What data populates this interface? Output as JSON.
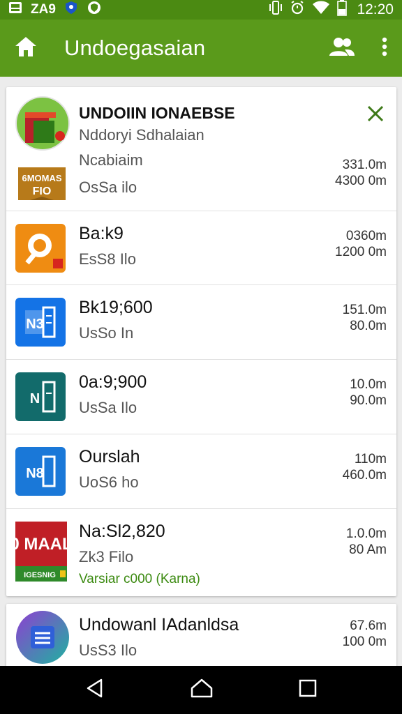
{
  "status_bar": {
    "left_text": "ZA9",
    "time": "12:20",
    "icons": [
      "gallery-icon",
      "shield-icon",
      "vibrate-icon",
      "alarm-icon",
      "wifi-icon",
      "battery-icon"
    ]
  },
  "app_bar": {
    "title": "Undoegasaian",
    "icons": [
      "home-icon",
      "people-icon",
      "more-vert-icon"
    ]
  },
  "items": [
    {
      "name": "UNDOIIN IONAEBSE",
      "line2": "Nddoryi Sdhalaian",
      "line3": "Ncabiaim",
      "line4": "OsSa ilo",
      "sizes": [
        "331.0m",
        "4300 0m"
      ],
      "badge_text": "6MOMAS FIO",
      "icon": "app-store-icon"
    },
    {
      "name": "Ba:k9",
      "sub": "EsS8 Ilo",
      "sizes": [
        "0360m",
        "1200 0m"
      ],
      "icon": "search-app-icon"
    },
    {
      "name": "Bk19;600",
      "sub": "UsSo In",
      "sizes": [
        "151.0m",
        "80.0m"
      ],
      "icon": "notes-app-icon"
    },
    {
      "name": "0a:9;900",
      "sub": "UsSa Ilo",
      "sizes": [
        "10.0m",
        "90.0m"
      ],
      "icon": "notes-app-icon"
    },
    {
      "name": "Ourslah",
      "sub": "UoS6 ho",
      "sizes": [
        "110m",
        "460.0m"
      ],
      "icon": "notes-app-icon"
    },
    {
      "name": "Na:Sl2,820",
      "sub": "Zk3 Filo",
      "extra": "Varsiar c000 (Karna)",
      "sizes": [
        "1.0.0m",
        "80 Am"
      ],
      "icon_top": "0 MAAL",
      "icon_bottom": "IGESNIG",
      "icon": "mail-app-icon"
    },
    {
      "name": "Undowanl IAdanldsa",
      "sub": "UsS3 Ilo",
      "sizes": [
        "67.6m",
        "100 0m"
      ],
      "icon": "document-app-icon"
    }
  ],
  "nav_bar": {
    "icons": [
      "back-icon",
      "home-circle-icon",
      "recents-icon"
    ]
  },
  "colors": {
    "status_bar": "#4b8a12",
    "app_bar": "#5a9a1b",
    "accent_green": "#3b8a10"
  }
}
